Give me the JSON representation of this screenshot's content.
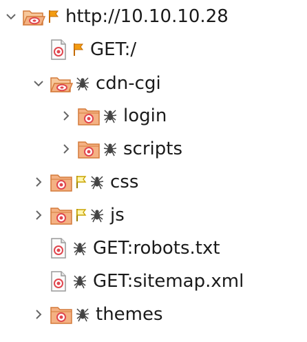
{
  "colors": {
    "folder_fill": "#f4b183",
    "folder_stroke": "#d47a3a",
    "target_red": "#e0464e",
    "flag_orange": "#f39c12",
    "flag_yellow": "#f2c200",
    "spider": "#444444",
    "chevron": "#666666",
    "text": "#1a1a1a"
  },
  "tree": {
    "nodes": [
      {
        "label": "http://10.10.10.28",
        "kind": "folder",
        "expanded": true,
        "has_chevron": true,
        "flag": "orange",
        "spider": false,
        "depth": 0
      },
      {
        "label": "GET:/",
        "kind": "file",
        "expanded": false,
        "has_chevron": false,
        "flag": "orange",
        "spider": false,
        "depth": 1
      },
      {
        "label": "cdn-cgi",
        "kind": "folder",
        "expanded": true,
        "has_chevron": true,
        "flag": "",
        "spider": true,
        "depth": 1
      },
      {
        "label": "login",
        "kind": "folder",
        "expanded": false,
        "has_chevron": true,
        "flag": "",
        "spider": true,
        "depth": 2
      },
      {
        "label": "scripts",
        "kind": "folder",
        "expanded": false,
        "has_chevron": true,
        "flag": "",
        "spider": true,
        "depth": 2
      },
      {
        "label": "css",
        "kind": "folder",
        "expanded": false,
        "has_chevron": true,
        "flag": "yellow",
        "spider": true,
        "depth": 1
      },
      {
        "label": "js",
        "kind": "folder",
        "expanded": false,
        "has_chevron": true,
        "flag": "yellow",
        "spider": true,
        "depth": 1
      },
      {
        "label": "GET:robots.txt",
        "kind": "file",
        "expanded": false,
        "has_chevron": false,
        "flag": "",
        "spider": true,
        "depth": 1
      },
      {
        "label": "GET:sitemap.xml",
        "kind": "file",
        "expanded": false,
        "has_chevron": false,
        "flag": "",
        "spider": true,
        "depth": 1
      },
      {
        "label": "themes",
        "kind": "folder",
        "expanded": false,
        "has_chevron": true,
        "flag": "",
        "spider": true,
        "depth": 1
      }
    ]
  }
}
